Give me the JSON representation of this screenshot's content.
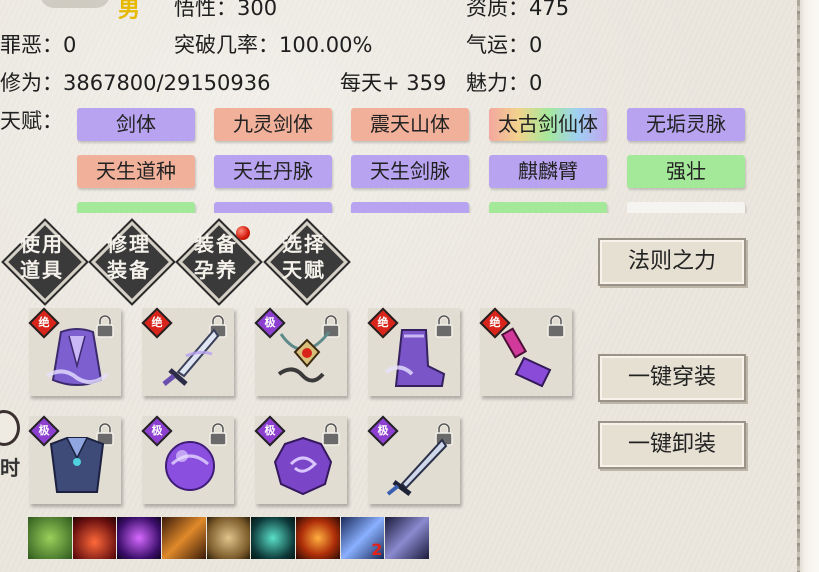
{
  "header": {
    "gender": "男",
    "comprehension": "悟性：300",
    "aptitude": "资质：475",
    "sin": "罪恶：0",
    "breakthrough": "突破几率：100.00%",
    "luck": "气运：0",
    "cultivation": "修为：3867800/29150936",
    "daily": "每天+ 359",
    "charm": "魅力：0"
  },
  "talents": {
    "label": "天赋：",
    "items": [
      {
        "label": "剑体",
        "color": "purple"
      },
      {
        "label": "九灵剑体",
        "color": "salmon"
      },
      {
        "label": "震天山体",
        "color": "salmon"
      },
      {
        "label": "太古剑仙体",
        "color": "rainbow"
      },
      {
        "label": "无垢灵脉",
        "color": "purple"
      },
      {
        "label": "天生道种",
        "color": "salmon"
      },
      {
        "label": "天生丹脉",
        "color": "purple"
      },
      {
        "label": "天生剑脉",
        "color": "purple"
      },
      {
        "label": "麒麟臂",
        "color": "purple"
      },
      {
        "label": "强壮",
        "color": "green"
      }
    ]
  },
  "actions": [
    {
      "label": "使用\n道具",
      "has_dot": false
    },
    {
      "label": "修理\n装备",
      "has_dot": false
    },
    {
      "label": "装备\n孕养",
      "has_dot": true
    },
    {
      "label": "选择\n天赋",
      "has_dot": false
    }
  ],
  "buttons": {
    "law_power": "法则之力",
    "equip_all": "一键穿装",
    "unequip_all": "一键卸装"
  },
  "equipment": [
    {
      "grade": "绝",
      "grade_color": "#d8241a",
      "icon": "robe-icon"
    },
    {
      "grade": "绝",
      "grade_color": "#d8241a",
      "icon": "sword-icon"
    },
    {
      "grade": "极",
      "grade_color": "#8d3fd0",
      "icon": "amulet-icon"
    },
    {
      "grade": "绝",
      "grade_color": "#d8241a",
      "icon": "boots-icon"
    },
    {
      "grade": "绝",
      "grade_color": "#d8241a",
      "icon": "chisel-icon"
    },
    {
      "grade": "极",
      "grade_color": "#8d3fd0",
      "icon": "armor-icon"
    },
    {
      "grade": "极",
      "grade_color": "#8d3fd0",
      "icon": "orb-icon"
    },
    {
      "grade": "极",
      "grade_color": "#8d3fd0",
      "icon": "seal-icon"
    },
    {
      "grade": "极",
      "grade_color": "#8d3fd0",
      "icon": "blade-icon"
    }
  ],
  "skills": [
    {
      "icon": "green-burst-icon"
    },
    {
      "icon": "red-sun-icon"
    },
    {
      "icon": "purple-void-icon"
    },
    {
      "icon": "flame-blade-icon"
    },
    {
      "icon": "taiji-icon"
    },
    {
      "icon": "teal-totem-icon"
    },
    {
      "icon": "fire-orb-icon"
    },
    {
      "icon": "wind-blade-icon",
      "badge": "2"
    },
    {
      "icon": "ice-thorn-icon"
    }
  ],
  "side_fragment": "时"
}
